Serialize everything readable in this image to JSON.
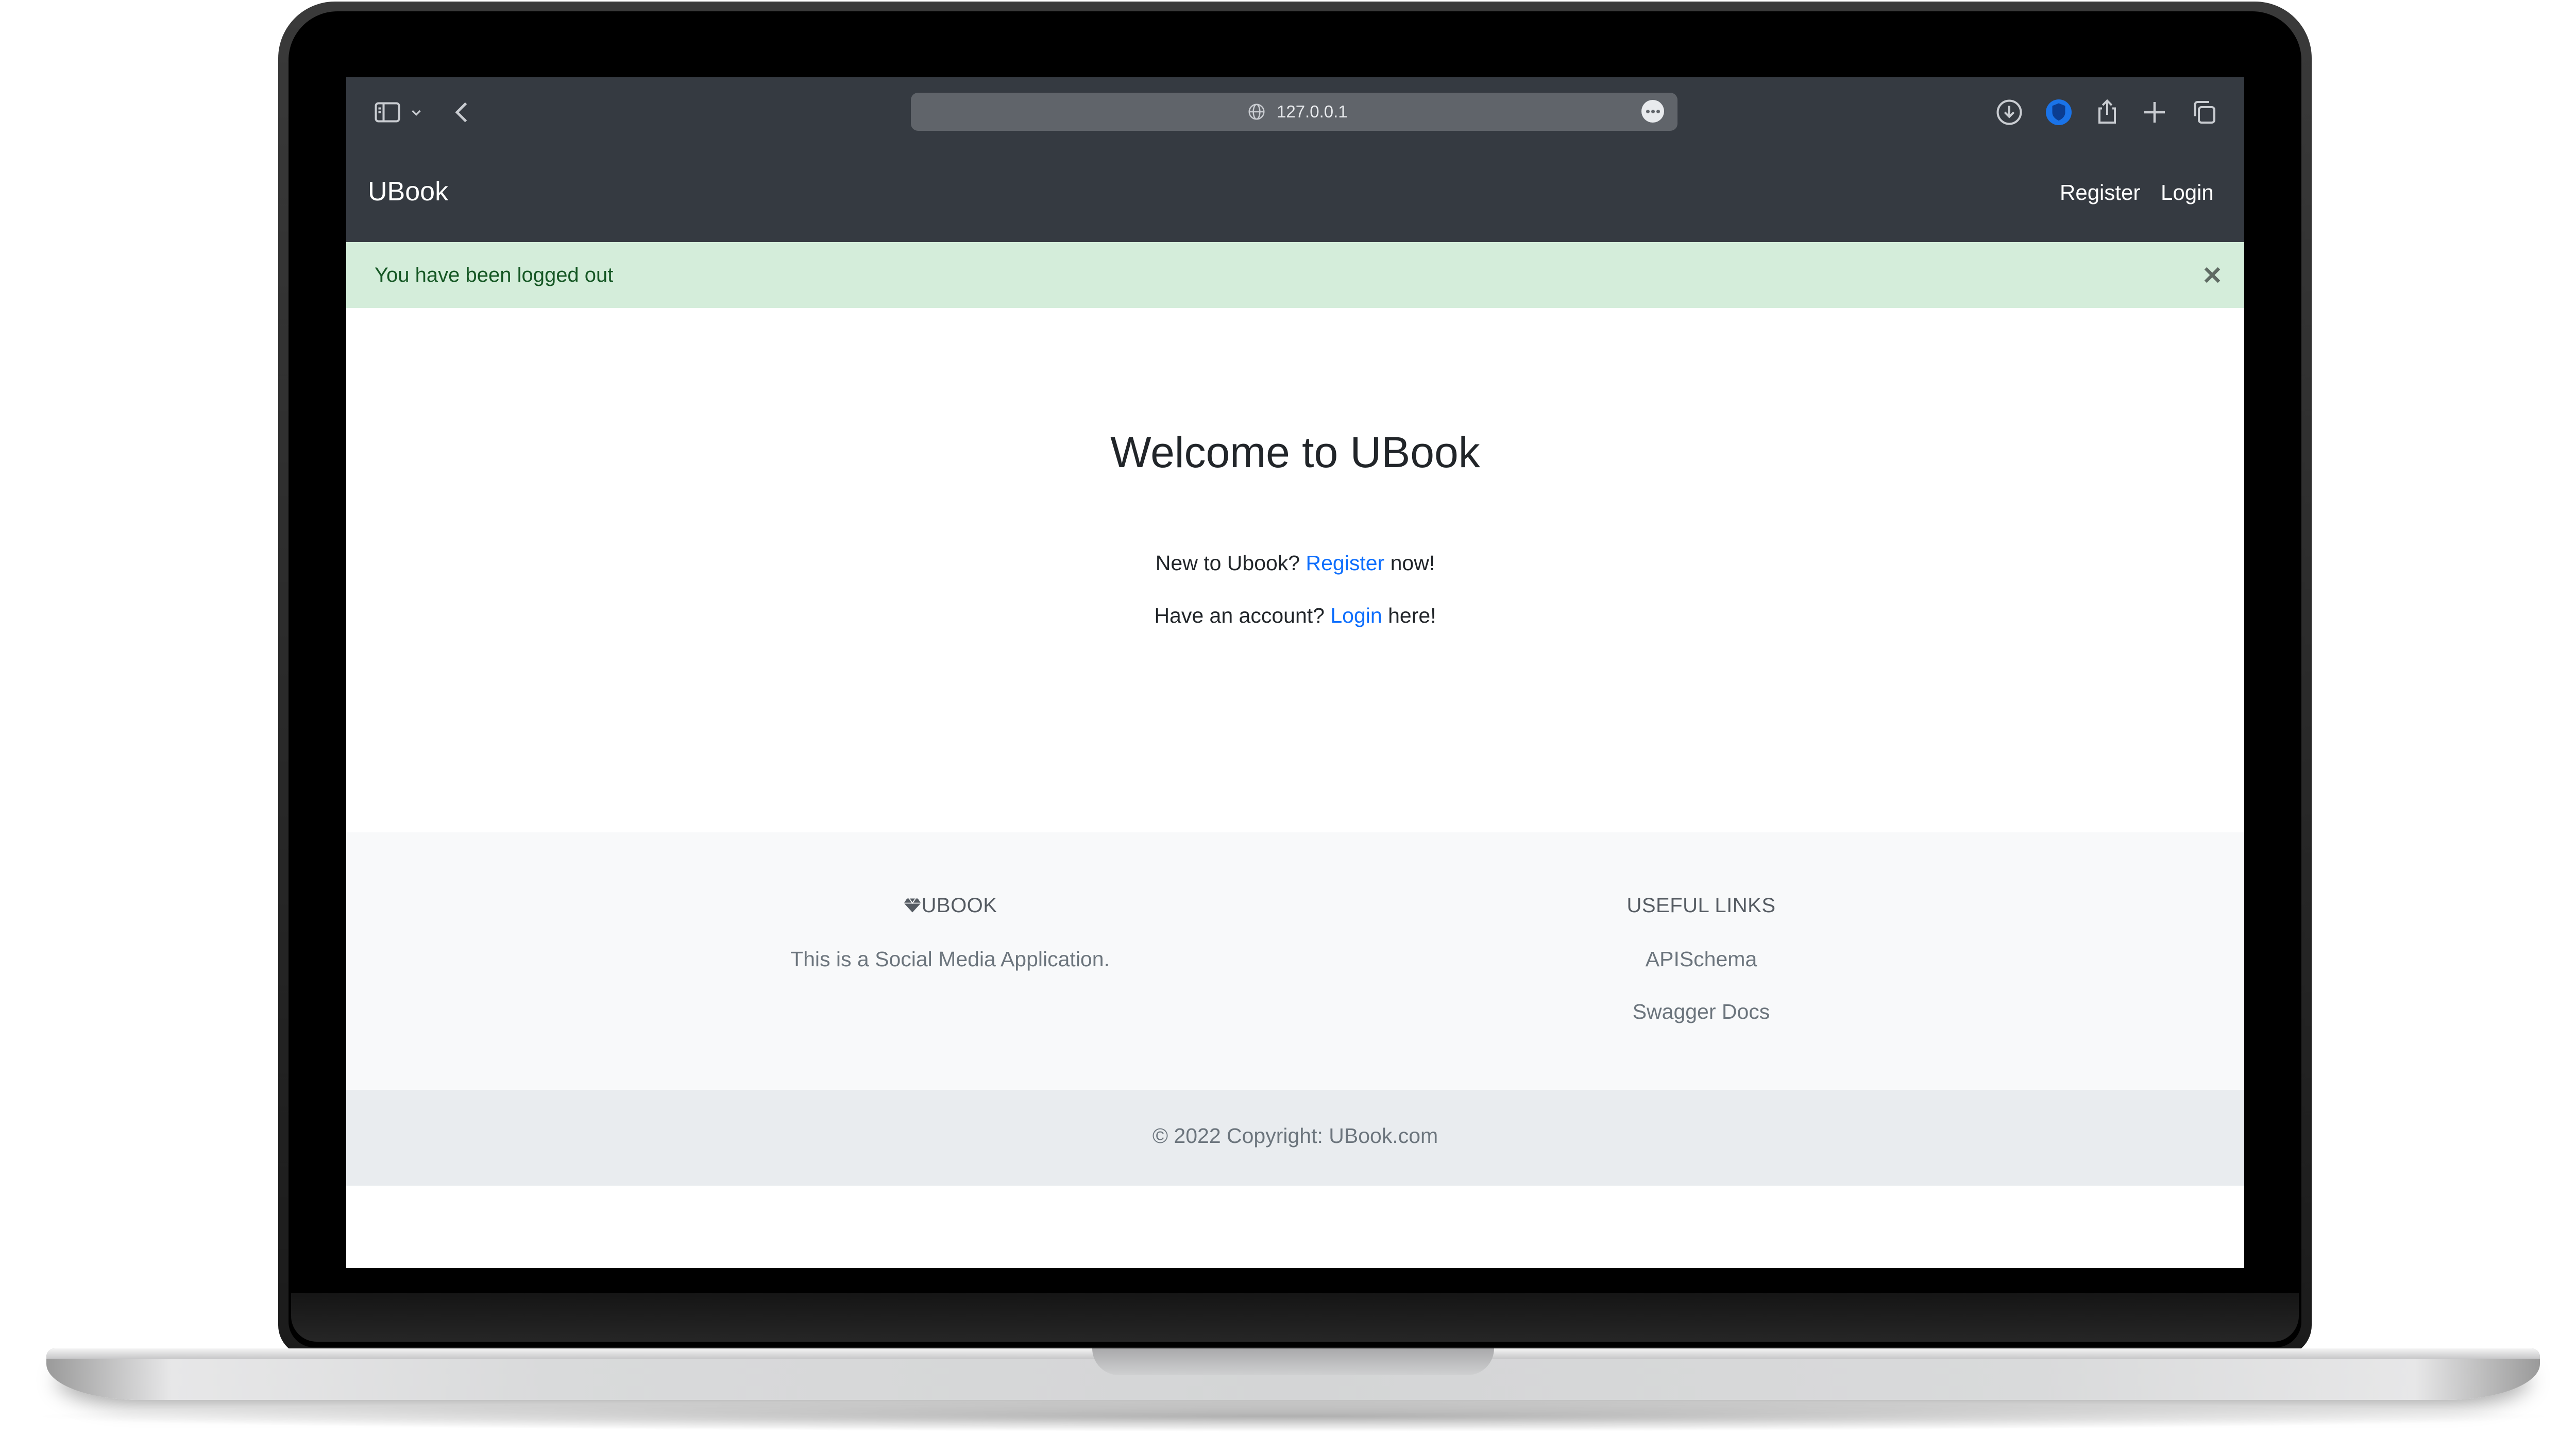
{
  "browser": {
    "url": "127.0.0.1"
  },
  "navbar": {
    "brand": "UBook",
    "register_label": "Register",
    "login_label": "Login"
  },
  "alert": {
    "message": "You have been logged out",
    "close_symbol": "×"
  },
  "main": {
    "heading": "Welcome to UBook",
    "register_prefix": "New to Ubook?",
    "register_link": "Register",
    "register_suffix": "now!",
    "login_prefix": "Have an account?",
    "login_link": "Login",
    "login_suffix": "here!"
  },
  "footer": {
    "brand_title": "UBOOK",
    "brand_icon": "gem-icon",
    "brand_text": "This is a Social Media Application.",
    "links_title": "USEFUL LINKS",
    "links": [
      "APISchema",
      "Swagger Docs"
    ],
    "copyright": "© 2022 Copyright: UBook.com"
  },
  "colors": {
    "navbar_bg": "#353a41",
    "alert_bg": "#d4edda",
    "alert_text": "#155724",
    "link": "#0d6efd",
    "footer_bg": "#f8f9fa",
    "copyright_bg": "#e9ecef"
  }
}
